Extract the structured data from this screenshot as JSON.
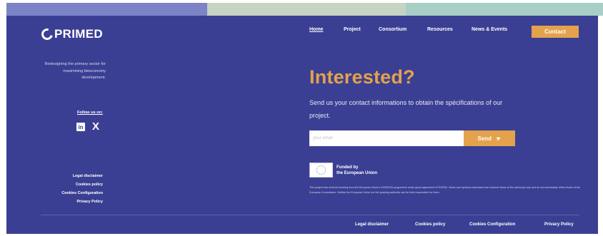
{
  "colors": {
    "background": "#3b3f93",
    "accent": "#e3a24b",
    "topbar": [
      "#7c83c6",
      "#c6d4c3",
      "#a8cfc5"
    ]
  },
  "header": {
    "logo": "PRIMED",
    "nav": [
      {
        "label": "Home",
        "active": true
      },
      {
        "label": "Project",
        "active": false
      },
      {
        "label": "Consortium",
        "active": false
      },
      {
        "label": "Resources",
        "active": false
      },
      {
        "label": "News & Events",
        "active": false
      }
    ],
    "contact_label": "Contact"
  },
  "sidebar": {
    "tagline": "Redesigning the primary sector for maximising bioeconomy development.",
    "follow_label": "Follow us on:",
    "socials": [
      {
        "icon": "linkedin-icon",
        "glyph": "in"
      },
      {
        "icon": "x-icon",
        "glyph": "X"
      }
    ],
    "legal": [
      "Legal disclaimer",
      "Cookies policy",
      "Cookies Configuration",
      "Privacy Policy"
    ]
  },
  "main": {
    "headline": "Interested?",
    "intro": "Send us your contact informations to obtain the spécifications of our project.",
    "email_placeholder": "your email",
    "send_label": "Send",
    "send_icon": "paper-plane-icon",
    "eu_label_line1": "Funded by",
    "eu_label_line2": "the European Union",
    "eu_note": "This project has received funding from the European Union's HORIZON programme under grant agreement N°000000. Views and opinions expressed are however those of the author(s) only and do not necessarily reflect those of the European Commission. Neither the European Union nor the granting authority can be held responsible for them."
  },
  "footer": {
    "legal": [
      "Legal disclaimer",
      "Cookies policy",
      "Cookies Configuration",
      "Privacy Policy"
    ]
  }
}
